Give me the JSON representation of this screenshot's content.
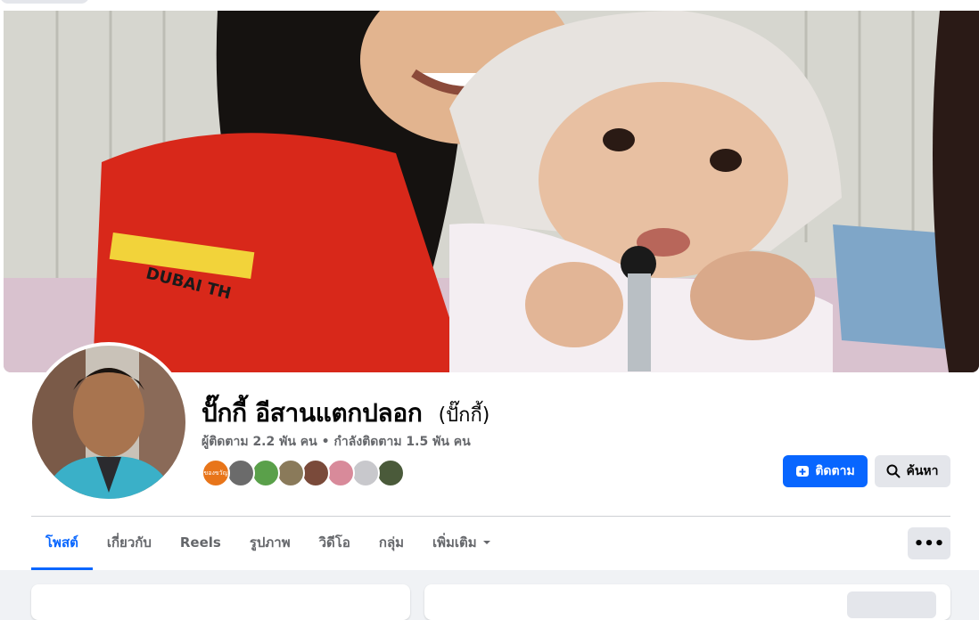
{
  "profile": {
    "name": "ปั๊กกี้ อีสานแตกปลอก",
    "alternate_name": "(ปั๊กกี้)",
    "followers": "ผู้ติดตาม 2.2 พัน คน",
    "separator": "•",
    "following": "กำลังติดตาม 1.5 พัน คน"
  },
  "friends": [
    {
      "color": "#e8751a",
      "text": "ของขวัญ"
    },
    {
      "color": "#6b6b6b",
      "text": ""
    },
    {
      "color": "#5aa04a",
      "text": ""
    },
    {
      "color": "#8a7a5a",
      "text": ""
    },
    {
      "color": "#7a4a3a",
      "text": ""
    },
    {
      "color": "#d88a9a",
      "text": ""
    },
    {
      "color": "#c8c8cc",
      "text": ""
    },
    {
      "color": "#4a5a3a",
      "text": ""
    }
  ],
  "actions": {
    "follow_label": "ติดตาม",
    "search_label": "ค้นหา",
    "more_label": "•••"
  },
  "tabs": [
    {
      "label": "โพสต์",
      "active": true
    },
    {
      "label": "เกี่ยวกับ",
      "active": false
    },
    {
      "label": "Reels",
      "active": false
    },
    {
      "label": "รูปภาพ",
      "active": false
    },
    {
      "label": "วิดีโอ",
      "active": false
    },
    {
      "label": "กลุ่ม",
      "active": false
    },
    {
      "label": "เพิ่มเติม",
      "active": false
    }
  ],
  "colors": {
    "accent": "#0866ff",
    "secondary_button": "#e4e6eb",
    "page_background": "#f0f2f5"
  }
}
